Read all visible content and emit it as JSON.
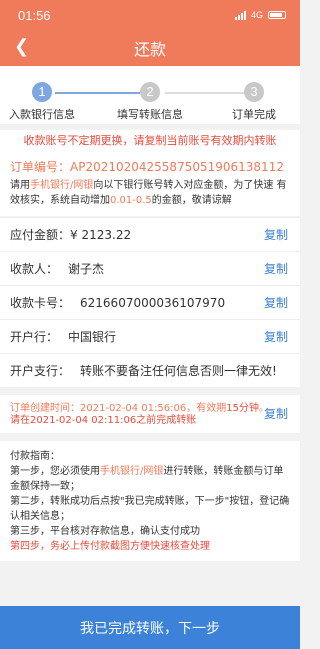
{
  "status_bar": {
    "time": "01:56",
    "network": "4G"
  },
  "nav": {
    "title": "还款"
  },
  "steps": [
    {
      "num": "1",
      "label": "入款银行信息"
    },
    {
      "num": "2",
      "label": "填写转账信息"
    },
    {
      "num": "3",
      "label": "订单完成"
    }
  ],
  "notice": "收款账号不定期更换，请复制当前账号有效期内转账",
  "order": {
    "order_no": "订单编号：AP20210204255875051906138112",
    "desc_pre": "请用",
    "desc_orange1": "手机银行/网银",
    "desc_mid": "向以下银行账号转入对应金额，为了快速 有效核实，系统自动增加",
    "desc_orange2": "0.01-0.5",
    "desc_post": "的金额，敬请谅解"
  },
  "rows": {
    "amount_label": "应付金额：",
    "amount_value": "¥ 2123.22",
    "payee_label": "收款人：",
    "payee_value": "谢子杰",
    "card_label": "收款卡号：",
    "card_value": "6216607000036107970",
    "bank_label": "开户行：",
    "bank_value": "中国银行",
    "branch_label": "开户支行：",
    "branch_value": "转账不要备注任何信息否则一律无效!",
    "copy_label": "复制"
  },
  "time_info": {
    "created_pre": "订单创建时间：",
    "created_time": "2021-02-04 01:56:06",
    "valid_pre": "，有效期",
    "valid_minutes": "15分钟",
    "valid_post": "。",
    "deadline": "请在2021-02-04 02:11:06之前完成转账",
    "copy_label": "复制"
  },
  "guide": {
    "title": "付款指南：",
    "s1_pre": "第一步，您必须使用",
    "s1_orange": "手机银行/网银",
    "s1_post": "进行转账，转账金额与订单金额保持一致；",
    "s2": "第二步，转账成功后点按\"我已完成转账，下一步\"按钮，登记确认相关信息；",
    "s3": "第三步，平台核对存款信息，确认支付成功",
    "s4": "第四步，务必上传付款截图方便快速核查处理"
  },
  "bottom_button": "我已完成转账，下一步",
  "colors": {
    "header": "#f07b5a",
    "active_step": "#7ea6e0",
    "link": "#3b82d8",
    "warning": "#e84b3c"
  }
}
